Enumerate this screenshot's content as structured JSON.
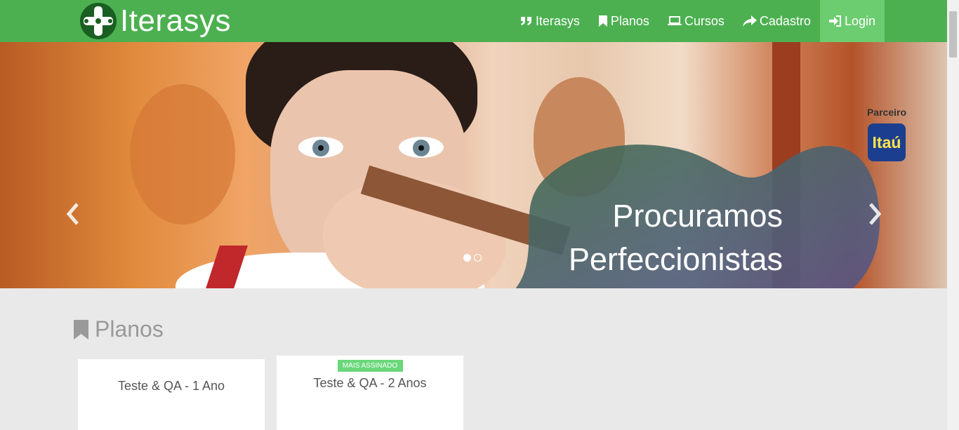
{
  "brand": {
    "name": "Iterasys",
    "logo_icon": "cross-dots-icon"
  },
  "nav": {
    "items": [
      {
        "label": "Iterasys",
        "icon": "quote-icon"
      },
      {
        "label": "Planos",
        "icon": "bookmark-icon"
      },
      {
        "label": "Cursos",
        "icon": "laptop-icon"
      },
      {
        "label": "Cadastro",
        "icon": "share-arrow-icon"
      },
      {
        "label": "Login",
        "icon": "login-icon",
        "active": true
      }
    ]
  },
  "carousel": {
    "title_line1": "Procuramos",
    "title_line2": "Perfeccionistas",
    "partner_label": "Parceiro",
    "partner_logo_text": "Itaú",
    "slides_count": 2,
    "active_slide": 1
  },
  "plans": {
    "heading": "Planos",
    "cards": [
      {
        "title": "Teste & QA - 1 Ano"
      },
      {
        "title": "Teste & QA - 2 Anos",
        "badge": "MAIS ASSINADO"
      }
    ]
  },
  "colors": {
    "navbar": "#4cb050",
    "nav_active": "#6ccc70",
    "badge": "#69d77a",
    "itau_blue": "#1b3e8f"
  }
}
